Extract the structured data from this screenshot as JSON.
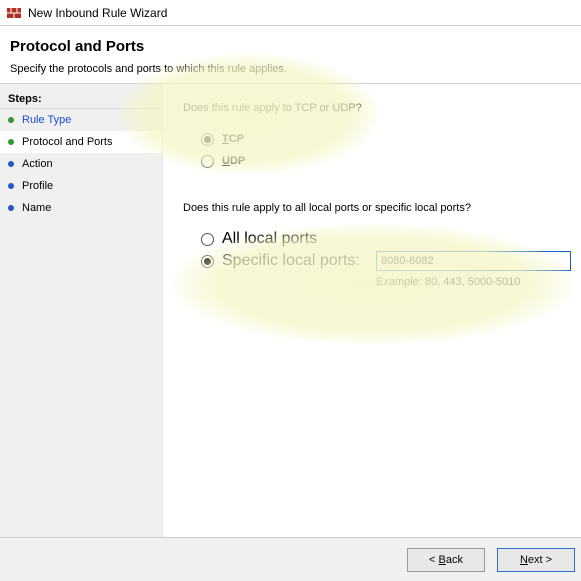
{
  "window": {
    "title": "New Inbound Rule Wizard"
  },
  "header": {
    "title": "Protocol and Ports",
    "subtitle": "Specify the protocols and ports to which this rule applies."
  },
  "steps": {
    "heading": "Steps:",
    "items": [
      {
        "label": "Rule Type",
        "status": "done"
      },
      {
        "label": "Protocol and Ports",
        "status": "current"
      },
      {
        "label": "Action",
        "status": "pending"
      },
      {
        "label": "Profile",
        "status": "pending"
      },
      {
        "label": "Name",
        "status": "pending"
      }
    ]
  },
  "content": {
    "protocol_question": "Does this rule apply to TCP or UDP?",
    "protocol": {
      "tcp_pre": "T",
      "tcp_rest": "CP",
      "udp_pre": "U",
      "udp_rest": "DP",
      "selected": "tcp"
    },
    "ports_question": "Does this rule apply to all local ports or specific local ports?",
    "ports": {
      "all_pre": "A",
      "all_rest": "ll local ports",
      "specific_pre": "S",
      "specific_rest": "pecific local ports:",
      "selected": "specific",
      "value": "8080-8082",
      "example": "Example: 80, 443, 5000-5010"
    }
  },
  "footer": {
    "back_pre": "< ",
    "back_u": "B",
    "back_rest": "ack",
    "next_pre": "",
    "next_u": "N",
    "next_rest": "ext >"
  }
}
